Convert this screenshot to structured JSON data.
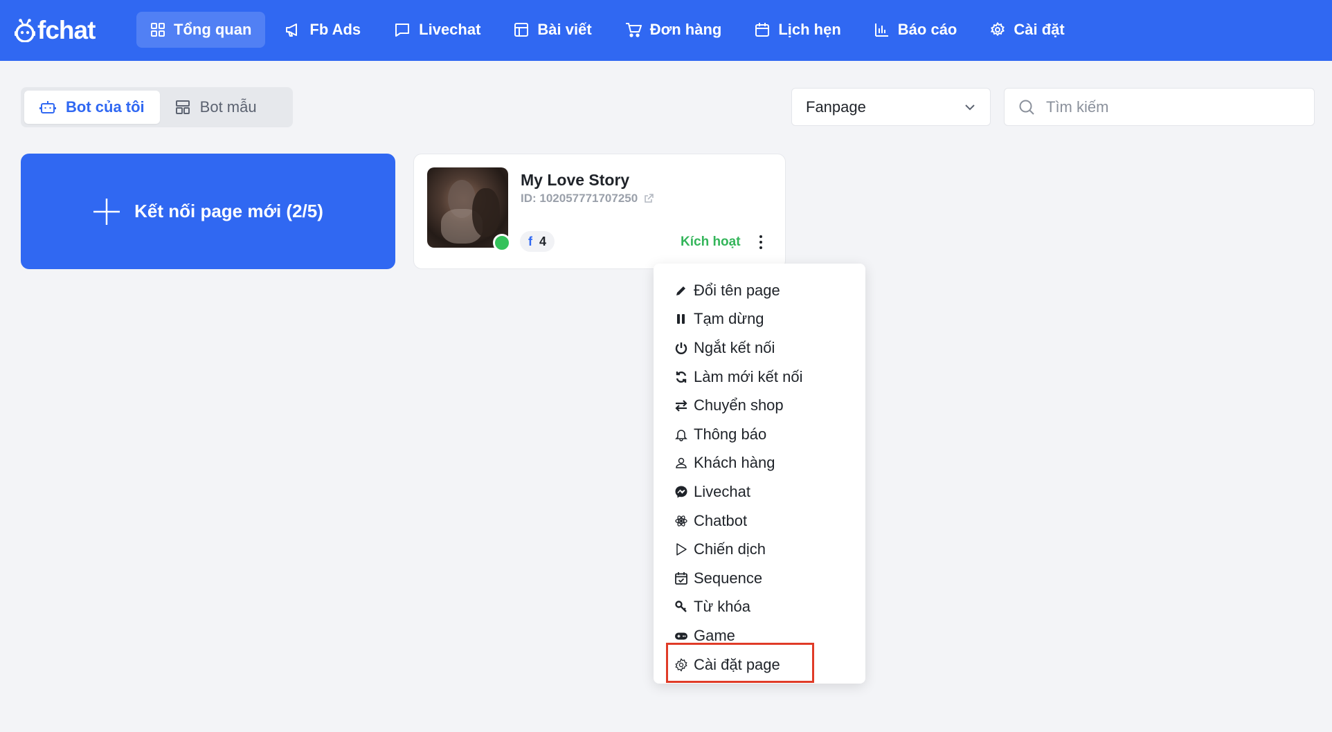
{
  "app": {
    "logo_text": "fchat"
  },
  "nav": {
    "items": [
      {
        "label": "Tổng quan",
        "icon": "dashboard-icon",
        "active": true
      },
      {
        "label": "Fb Ads",
        "icon": "megaphone-icon"
      },
      {
        "label": "Livechat",
        "icon": "chat-bubble-icon"
      },
      {
        "label": "Bài viết",
        "icon": "layout-icon"
      },
      {
        "label": "Đơn hàng",
        "icon": "cart-icon"
      },
      {
        "label": "Lịch hẹn",
        "icon": "calendar-icon"
      },
      {
        "label": "Báo cáo",
        "icon": "bar-chart-icon"
      },
      {
        "label": "Cài đặt",
        "icon": "gear-icon"
      }
    ]
  },
  "tabs": {
    "my_bots": "Bot của tôi",
    "template_bots": "Bot mẫu"
  },
  "filter": {
    "selected": "Fanpage"
  },
  "search": {
    "placeholder": "Tìm kiếm"
  },
  "connect_card": {
    "label": "Kết nối page mới (2/5)"
  },
  "page_card": {
    "name": "My Love Story",
    "id": "ID: 102057771707250",
    "fb_count": "4",
    "status": "Kích hoạt",
    "status_color": "#34b55a"
  },
  "context_menu": {
    "items": [
      {
        "label": "Đổi tên page",
        "icon": "pencil-icon"
      },
      {
        "label": "Tạm dừng",
        "icon": "pause-icon"
      },
      {
        "label": "Ngắt kết nối",
        "icon": "power-icon"
      },
      {
        "label": "Làm mới kết nối",
        "icon": "refresh-icon"
      },
      {
        "label": "Chuyển shop",
        "icon": "swap-icon"
      },
      {
        "label": "Thông báo",
        "icon": "bell-icon"
      },
      {
        "label": "Khách hàng",
        "icon": "user-icon"
      },
      {
        "label": "Livechat",
        "icon": "messenger-icon"
      },
      {
        "label": "Chatbot",
        "icon": "atom-icon"
      },
      {
        "label": "Chiến dịch",
        "icon": "play-icon"
      },
      {
        "label": "Sequence",
        "icon": "calendar-check-icon"
      },
      {
        "label": "Từ khóa",
        "icon": "key-icon"
      },
      {
        "label": "Game",
        "icon": "gamepad-icon"
      },
      {
        "label": "Cài đặt page",
        "icon": "gear-icon",
        "highlighted": true
      }
    ]
  },
  "colors": {
    "primary": "#3068f2",
    "highlight_border": "#e03b27",
    "online": "#34c25b"
  }
}
